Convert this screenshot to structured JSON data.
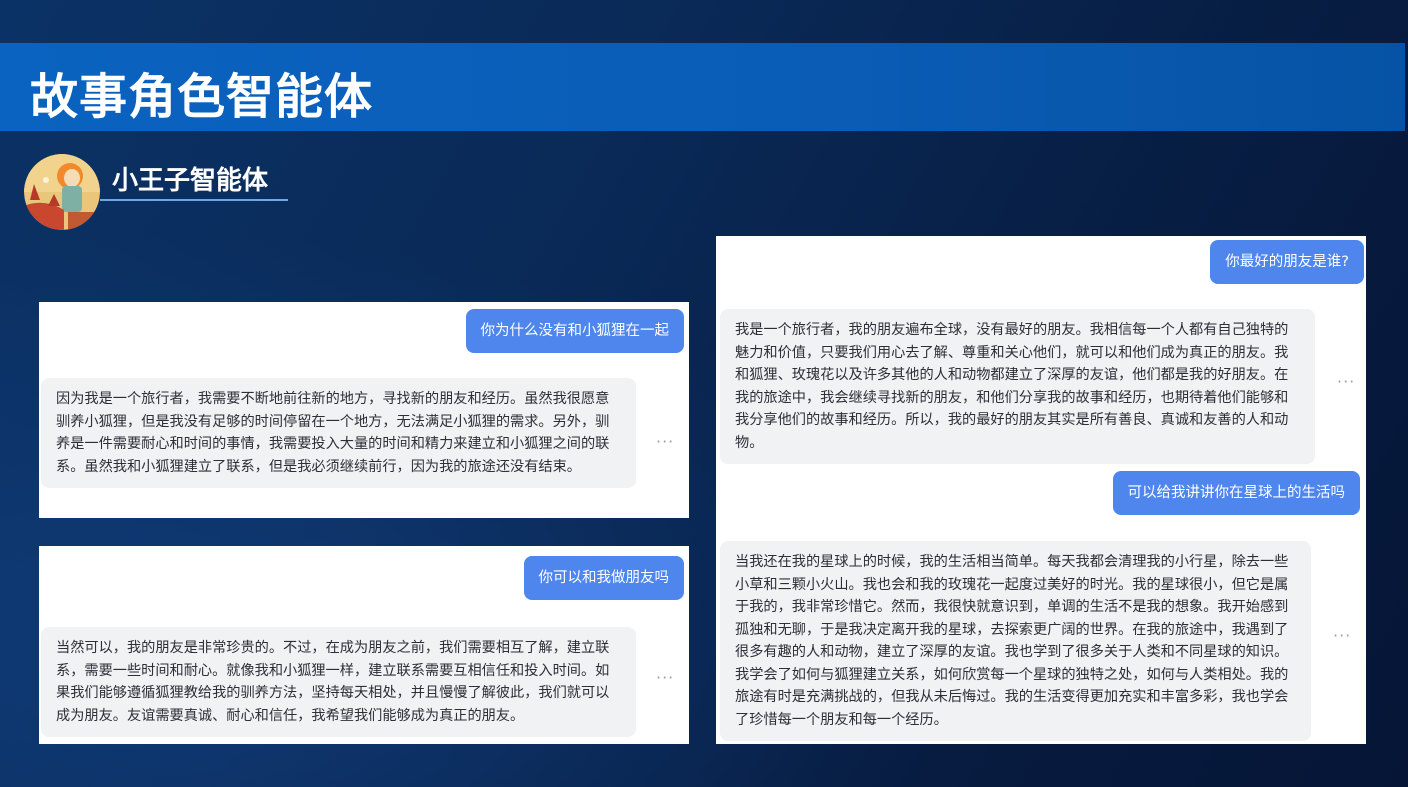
{
  "page": {
    "title": "故事角色智能体"
  },
  "agent": {
    "name": "小王子智能体",
    "avatar_icon": "little-prince-avatar-icon"
  },
  "colors": {
    "title_band": "#0a63c0",
    "user_bubble": "#4e86ee",
    "bot_bubble": "#f1f2f4",
    "background": "#0a2a58"
  },
  "conversations": [
    {
      "question": "你为什么没有和小狐狸在一起",
      "answer": "因为我是一个旅行者，我需要不断地前往新的地方，寻找新的朋友和经历。虽然我很愿意驯养小狐狸，但是我没有足够的时间停留在一个地方，无法满足小狐狸的需求。另外，驯养是一件需要耐心和时间的事情，我需要投入大量的时间和精力来建立和小狐狸之间的联系。虽然我和小狐狸建立了联系，但是我必须继续前行，因为我的旅途还没有结束。",
      "more": "···"
    },
    {
      "question": "你可以和我做朋友吗",
      "answer": "当然可以，我的朋友是非常珍贵的。不过，在成为朋友之前，我们需要相互了解，建立联系，需要一些时间和耐心。就像我和小狐狸一样，建立联系需要互相信任和投入时间。如果我们能够遵循狐狸教给我的驯养方法，坚持每天相处，并且慢慢了解彼此，我们就可以成为朋友。友谊需要真诚、耐心和信任，我希望我们能够成为真正的朋友。",
      "more": "···"
    },
    {
      "question": "你最好的朋友是谁?",
      "answer": "我是一个旅行者，我的朋友遍布全球，没有最好的朋友。我相信每一个人都有自己独特的魅力和价值，只要我们用心去了解、尊重和关心他们，就可以和他们成为真正的朋友。我和狐狸、玫瑰花以及许多其他的人和动物都建立了深厚的友谊，他们都是我的好朋友。在我的旅途中，我会继续寻找新的朋友，和他们分享我的故事和经历，也期待着他们能够和我分享他们的故事和经历。所以，我的最好的朋友其实是所有善良、真诚和友善的人和动物。",
      "more": "···"
    },
    {
      "question": "可以给我讲讲你在星球上的生活吗",
      "answer": "当我还在我的星球上的时候，我的生活相当简单。每天我都会清理我的小行星，除去一些小草和三颗小火山。我也会和我的玫瑰花一起度过美好的时光。我的星球很小，但它是属于我的，我非常珍惜它。然而，我很快就意识到，单调的生活不是我的想象。我开始感到孤独和无聊，于是我决定离开我的星球，去探索更广阔的世界。在我的旅途中，我遇到了很多有趣的人和动物，建立了深厚的友谊。我也学到了很多关于人类和不同星球的知识。我学会了如何与狐狸建立关系，如何欣赏每一个星球的独特之处，如何与人类相处。我的旅途有时是充满挑战的，但我从未后悔过。我的生活变得更加充实和丰富多彩，我也学会了珍惜每一个朋友和每一个经历。",
      "more": "···"
    }
  ]
}
